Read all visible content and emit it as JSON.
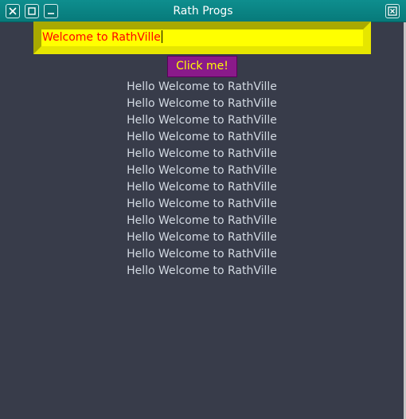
{
  "window": {
    "title": "Rath Progs",
    "buttons": [
      "close-icon",
      "maximize-icon",
      "minimize-icon",
      "window-menu-icon"
    ]
  },
  "entry": {
    "value": "Welcome to RathVille",
    "text_color": "#ff0000",
    "background": "#ffff00"
  },
  "button": {
    "label": "Click me!",
    "background": "#8a1a8a",
    "text_color": "#ffff00"
  },
  "output": {
    "lines": [
      "Hello Welcome to RathVille",
      "Hello Welcome to RathVille",
      "Hello Welcome to RathVille",
      "Hello Welcome to RathVille",
      "Hello Welcome to RathVille",
      "Hello Welcome to RathVille",
      "Hello Welcome to RathVille",
      "Hello Welcome to RathVille",
      "Hello Welcome to RathVille",
      "Hello Welcome to RathVille",
      "Hello Welcome to RathVille",
      "Hello Welcome to RathVille"
    ]
  },
  "colors": {
    "window_bg": "#383c4a",
    "titlebar": "#0e8e8e",
    "output_text": "#d3dae3"
  }
}
